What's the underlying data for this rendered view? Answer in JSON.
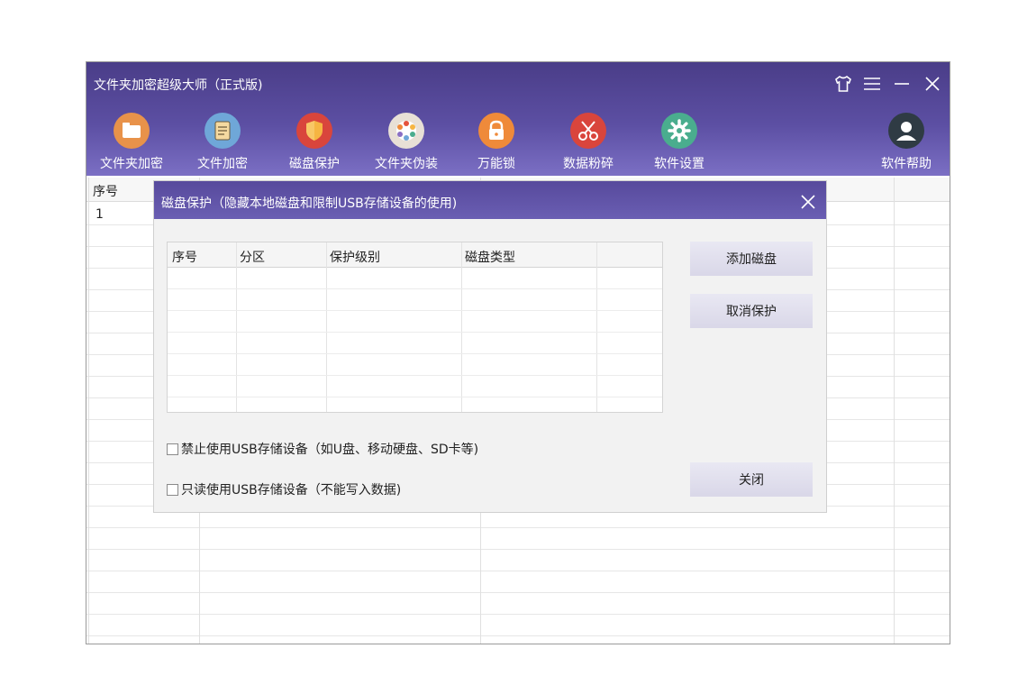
{
  "window": {
    "title": "文件夹加密超级大师（正式版)",
    "controls": [
      {
        "name": "skin-icon"
      },
      {
        "name": "menu-icon"
      },
      {
        "name": "minimize-icon"
      },
      {
        "name": "close-icon"
      }
    ]
  },
  "toolbar": {
    "items": [
      {
        "label": "文件夹加密",
        "icon": "folder-icon",
        "color": "#e8924a"
      },
      {
        "label": "文件加密",
        "icon": "document-icon",
        "color": "#6fa7d8"
      },
      {
        "label": "磁盘保护",
        "icon": "shield-icon",
        "color": "#d9453c"
      },
      {
        "label": "文件夹伪装",
        "icon": "palette-icon",
        "color": "#e8e0d6"
      },
      {
        "label": "万能锁",
        "icon": "lock-icon",
        "color": "#ef8a3a"
      },
      {
        "label": "数据粉碎",
        "icon": "scissors-icon",
        "color": "#d9453c"
      },
      {
        "label": "软件设置",
        "icon": "gear-icon",
        "color": "#4aad8e"
      },
      {
        "label": "软件帮助",
        "icon": "user-icon",
        "color": "#2f3b44"
      }
    ]
  },
  "main_table": {
    "headers": [
      "序号"
    ],
    "rows": [
      [
        "1"
      ]
    ]
  },
  "dialog": {
    "title": "磁盘保护（隐藏本地磁盘和限制USB存储设备的使用)",
    "table": {
      "headers": [
        "序号",
        "分区",
        "保护级别",
        "磁盘类型",
        ""
      ]
    },
    "buttons": {
      "add": "添加磁盘",
      "cancel_protect": "取消保护",
      "close": "关闭"
    },
    "options": [
      {
        "label": "禁止使用USB存储设备（如U盘、移动硬盘、SD卡等)",
        "checked": false
      },
      {
        "label": "只读使用USB存储设备（不能写入数据)",
        "checked": false
      }
    ]
  }
}
